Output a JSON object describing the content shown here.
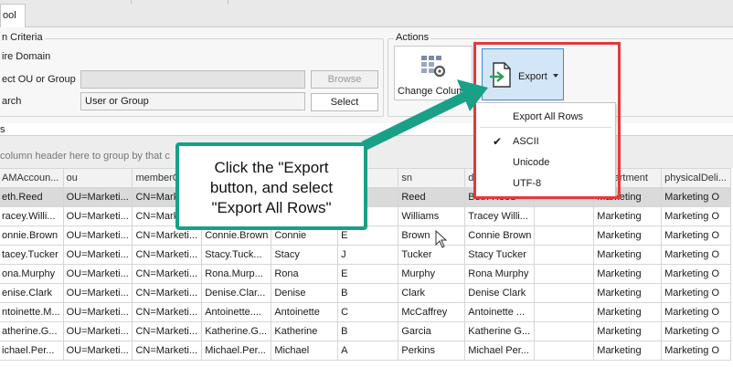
{
  "tabs": {
    "active_label": "ool"
  },
  "search_criteria": {
    "title": "n Criteria",
    "entire_domain_label": "ire Domain",
    "select_ou_label": "ect OU or Group",
    "ou_field_value": "",
    "browse_label": "Browse",
    "search_label": "arch",
    "search_value": "User or Group",
    "select_label": "Select"
  },
  "actions": {
    "title": "Actions",
    "change_columns_label": "Change Columns",
    "export_label": "Export"
  },
  "export_menu": {
    "items": [
      {
        "label": "Export All Rows"
      },
      {
        "label": "ASCII"
      },
      {
        "label": "Unicode"
      },
      {
        "label": "UTF-8"
      }
    ],
    "checked": "ASCII"
  },
  "grid": {
    "label": "s",
    "group_hint": "column header here to group by that c",
    "columns": [
      "AMAccoun...",
      "ou",
      "memberO...",
      "",
      "",
      "",
      "sn",
      "d",
      "",
      "department",
      "physicalDeli..."
    ],
    "rows": [
      [
        "eth.Reed",
        "OU=Marketi...",
        "CN=Marke",
        "",
        "",
        "",
        "Reed",
        "Beth Reed",
        "",
        "Marketing",
        "Marketing O"
      ],
      [
        "racey.Willi...",
        "OU=Marketi...",
        "CN=Marke",
        "",
        "",
        "",
        "Williams",
        "Tracey Willi...",
        "",
        "Marketing",
        "Marketing O"
      ],
      [
        "onnie.Brown",
        "OU=Marketi...",
        "CN=Marketi...",
        "Connie.Brown",
        "Connie",
        "E",
        "Brown",
        "Connie Brown",
        "",
        "Marketing",
        "Marketing O"
      ],
      [
        "tacey.Tucker",
        "OU=Marketi...",
        "CN=Marketi...",
        "Stacy.Tuck...",
        "Stacy",
        "J",
        "Tucker",
        "Stacy Tucker",
        "",
        "Marketing",
        "Marketing O"
      ],
      [
        "ona.Murphy",
        "OU=Marketi...",
        "CN=Marketi...",
        "Rona.Murp...",
        "Rona",
        "E",
        "Murphy",
        "Rona Murphy",
        "",
        "Marketing",
        "Marketing O"
      ],
      [
        "enise.Clark",
        "OU=Marketi...",
        "CN=Marketi...",
        "Denise.Clar...",
        "Denise",
        "B",
        "Clark",
        "Denise Clark",
        "",
        "Marketing",
        "Marketing O"
      ],
      [
        "ntoinette.M...",
        "OU=Marketi...",
        "CN=Marketi...",
        "Antoinette....",
        "Antoinette",
        "C",
        "McCaffrey",
        "Antoinette ...",
        "",
        "Marketing",
        "Marketing O"
      ],
      [
        "atherine.G...",
        "OU=Marketi...",
        "CN=Marketi...",
        "Katherine.G...",
        "Katherine",
        "B",
        "Garcia",
        "Katherine G...",
        "",
        "Marketing",
        "Marketing O"
      ],
      [
        "ichael.Per...",
        "OU=Marketi...",
        "CN=Marketi...",
        "Michael.Per...",
        "Michael",
        "A",
        "Perkins",
        "Michael Per...",
        "",
        "Marketing",
        "Marketing O"
      ]
    ]
  },
  "callout": {
    "lines": [
      "Click the \"Export",
      "button, and select",
      "\"Export All Rows\""
    ]
  },
  "colors": {
    "highlight_red": "#e03b3b",
    "callout_green": "#19a086",
    "export_bg": "#d3e6f8",
    "export_border": "#3e8bd6"
  }
}
